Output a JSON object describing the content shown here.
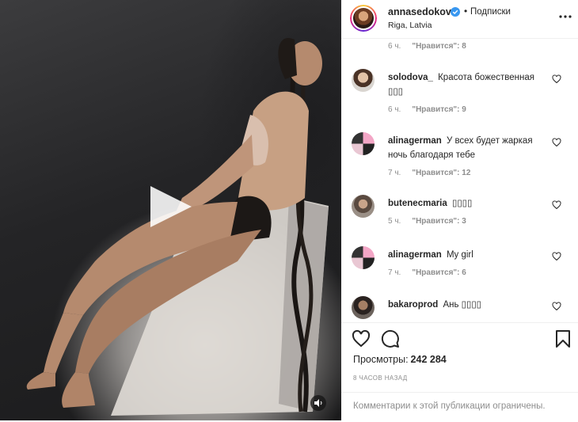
{
  "post": {
    "username": "annasedokova",
    "verified": true,
    "follow_label": "Подписки",
    "location": "Riga, Latvia"
  },
  "comments": [
    {
      "author": "",
      "text": "",
      "time": "6 ч.",
      "likes": "\"Нравится\": 8",
      "partial": true
    },
    {
      "author": "solodova_",
      "text": "Красота божественная ▯▯▯",
      "time": "6 ч.",
      "likes": "\"Нравится\": 9"
    },
    {
      "author": "alinagerman",
      "text": "У всех будет жаркая ночь благодаря тебе",
      "time": "7 ч.",
      "likes": "\"Нравится\": 12"
    },
    {
      "author": "butenecmaria",
      "text": "▯▯▯▯",
      "time": "5 ч.",
      "likes": "\"Нравится\": 3"
    },
    {
      "author": "alinagerman",
      "text": "My girl",
      "time": "7 ч.",
      "likes": "\"Нравится\": 6"
    },
    {
      "author": "bakaroprod",
      "text": "Ань ▯▯▯▯",
      "time": "",
      "likes": ""
    }
  ],
  "stats": {
    "views_label": "Просмотры:",
    "views_count": "242 284",
    "time_ago": "8 часов назад"
  },
  "comments_closed": "Комментарии к этой публикации ограничены.",
  "icons": {
    "play": "play-icon",
    "sound": "sound-icon",
    "verified": "verified-badge-icon",
    "more": "more-options-icon",
    "heart": "heart-icon",
    "comment": "comment-icon",
    "bookmark": "bookmark-icon"
  },
  "colors": {
    "verified_blue": "#3897f0",
    "muted_text": "#8e8e8e",
    "text": "#262626"
  }
}
